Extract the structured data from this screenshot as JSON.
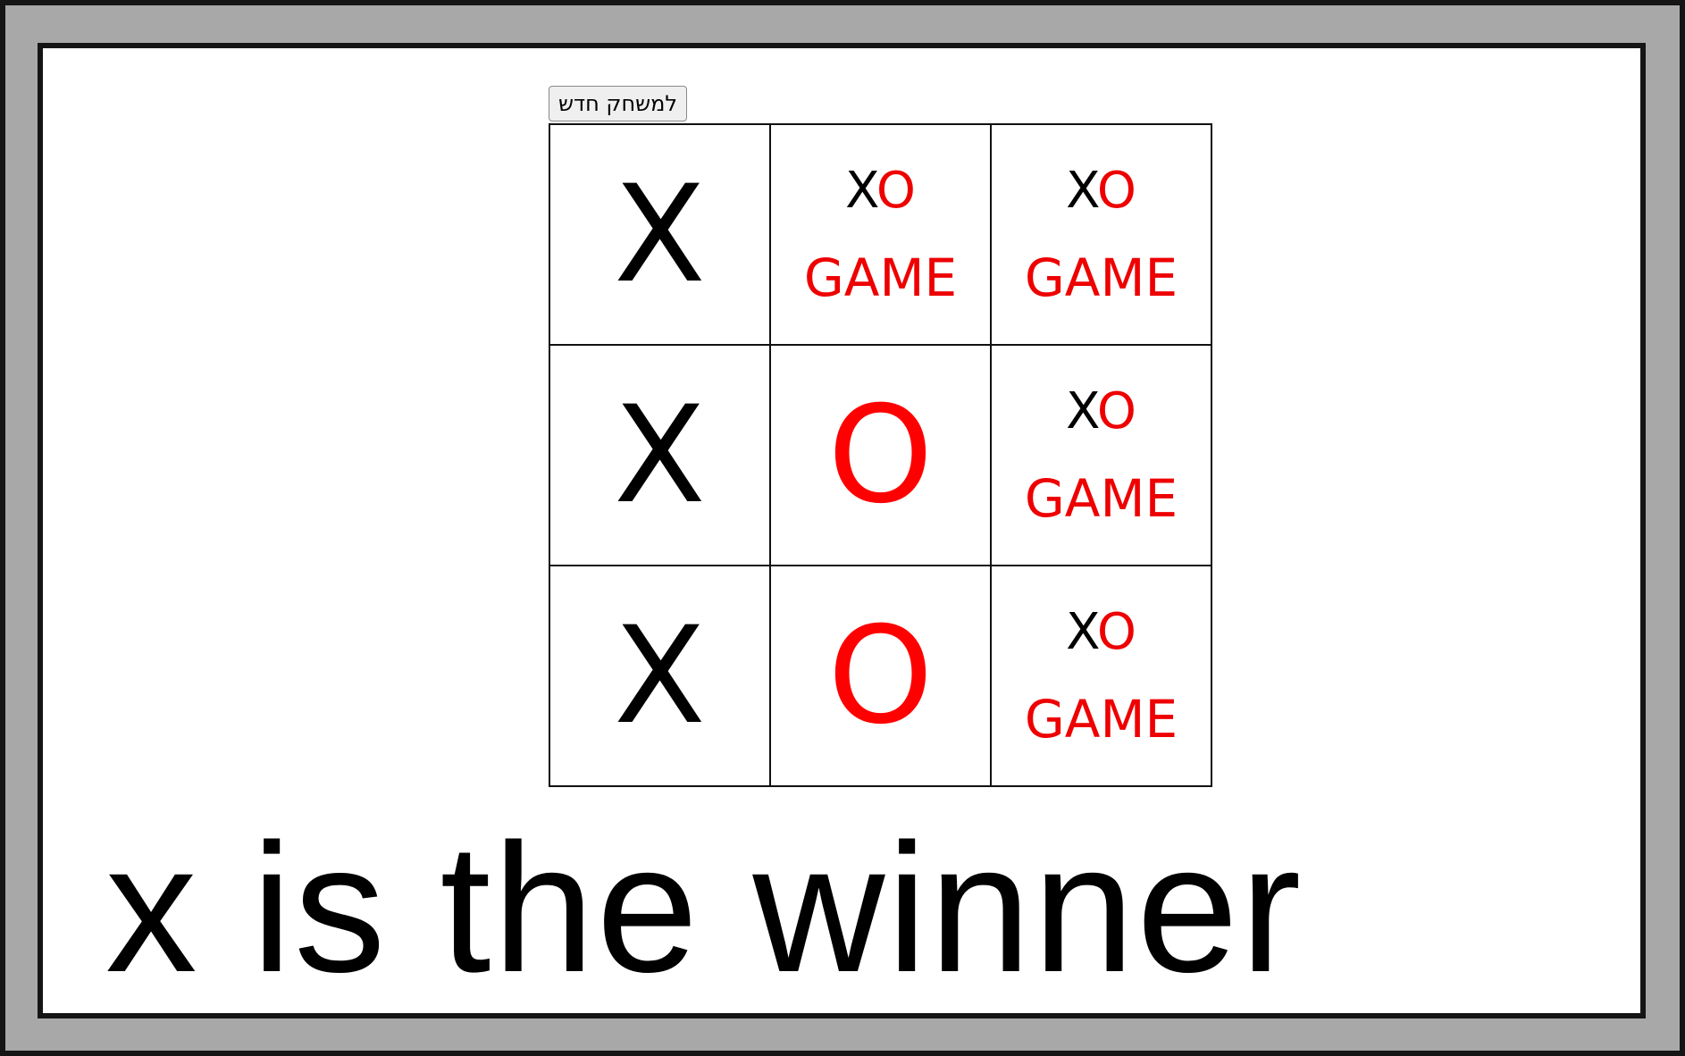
{
  "new_game_button": "למשחק חדש",
  "board": [
    [
      {
        "mark": "X"
      },
      {
        "placeholder": true
      },
      {
        "placeholder": true
      }
    ],
    [
      {
        "mark": "X"
      },
      {
        "mark": "O"
      },
      {
        "placeholder": true
      }
    ],
    [
      {
        "mark": "X"
      },
      {
        "mark": "O"
      },
      {
        "placeholder": true
      }
    ]
  ],
  "placeholder": {
    "x": "X",
    "o": "O",
    "game": "GAME"
  },
  "status": "x is the winner",
  "colors": {
    "x": "#000000",
    "o": "#ff0000"
  }
}
